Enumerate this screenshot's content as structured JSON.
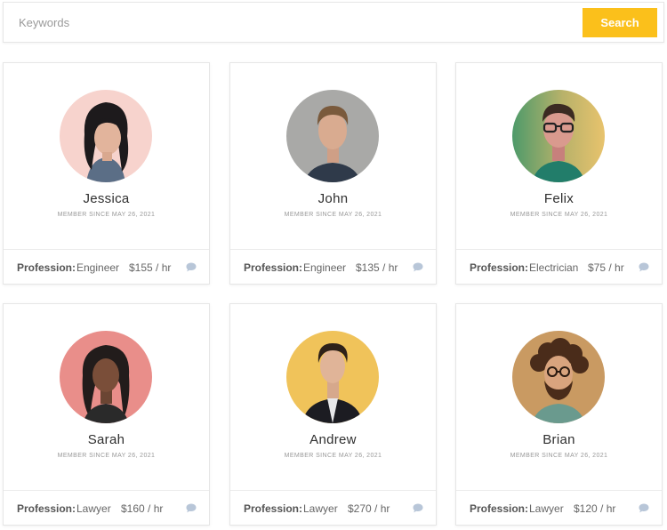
{
  "search": {
    "placeholder": "Keywords",
    "value": "",
    "button_label": "Search"
  },
  "colors": {
    "accent": "#fbc01b",
    "border": "#e6e6e6",
    "chat_icon": "#b8c6d8"
  },
  "profession_label": "Profession:",
  "profiles": [
    {
      "name": "Jessica",
      "member_since": "MEMBER SINCE MAY 26, 2021",
      "profession": "Engineer",
      "rate": "$155 / hr",
      "avatar_bg": "#f7d3cd",
      "icon": "chat-icon"
    },
    {
      "name": "John",
      "member_since": "MEMBER SINCE MAY 26, 2021",
      "profession": "Engineer",
      "rate": "$135 / hr",
      "avatar_bg": "#a9a9a7",
      "icon": "chat-icon"
    },
    {
      "name": "Felix",
      "member_since": "MEMBER SINCE MAY 26, 2021",
      "profession": "Electrician",
      "rate": "$75 / hr",
      "avatar_bg": "#7fb06e",
      "icon": "chat-icon"
    },
    {
      "name": "Sarah",
      "member_since": "MEMBER SINCE MAY 26, 2021",
      "profession": "Lawyer",
      "rate": "$160 / hr",
      "avatar_bg": "#e98e8a",
      "icon": "chat-icon"
    },
    {
      "name": "Andrew",
      "member_since": "MEMBER SINCE MAY 26, 2021",
      "profession": "Lawyer",
      "rate": "$270 / hr",
      "avatar_bg": "#f0c35a",
      "icon": "chat-icon"
    },
    {
      "name": "Brian",
      "member_since": "MEMBER SINCE MAY 26, 2021",
      "profession": "Lawyer",
      "rate": "$120 / hr",
      "avatar_bg": "#c99a62",
      "icon": "chat-icon"
    }
  ]
}
